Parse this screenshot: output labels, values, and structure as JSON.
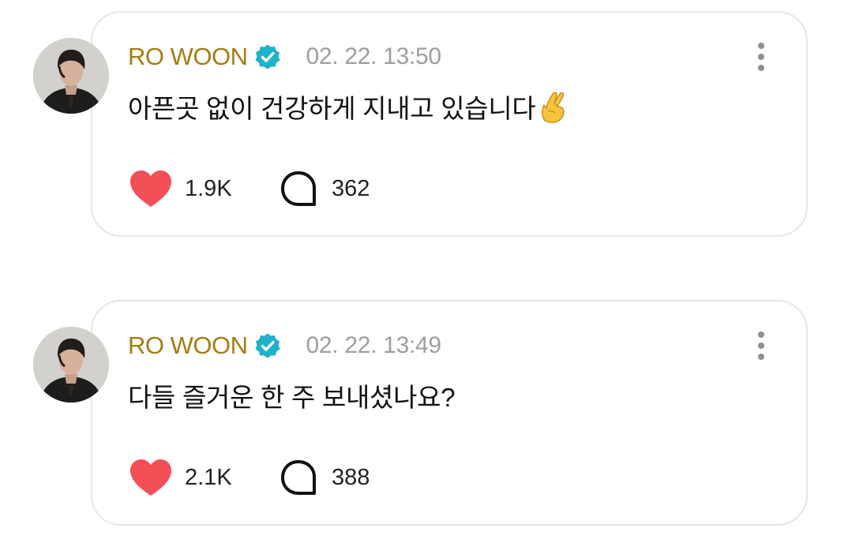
{
  "posts": [
    {
      "author": "RO WOON",
      "timestamp": "02. 22. 13:50",
      "text": "아픈곳 없이 건강하게 지내고 있습니다",
      "emoji": "crossed-fingers",
      "likes": "1.9K",
      "comments": "362"
    },
    {
      "author": "RO WOON",
      "timestamp": "02. 22. 13:49",
      "text": "다들 즐거운 한 주 보내셨나요?",
      "likes": "2.1K",
      "comments": "388"
    }
  ],
  "colors": {
    "author": "#a57c11",
    "verified_badge": "#1fb2c9",
    "timestamp": "#9e9e9e",
    "heart": "#f24f56",
    "card_border": "#e7e7e7"
  },
  "icons": {
    "verified": "verified-badge-icon",
    "more": "more-vertical-icon",
    "like": "heart-icon",
    "comment": "comment-bubble-icon"
  }
}
